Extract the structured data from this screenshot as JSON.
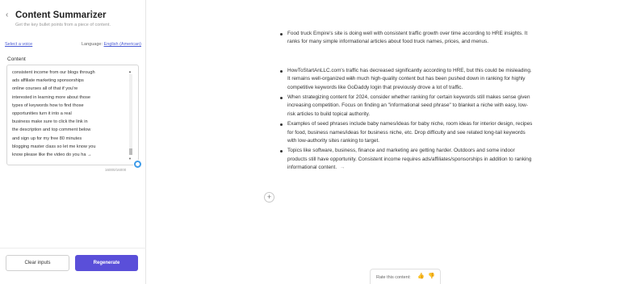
{
  "header": {
    "back_icon": "chevron-left-icon",
    "title": "Content Summarizer",
    "star_icon": "star-icon",
    "subtitle": "Get the key bullet points from a piece of content."
  },
  "voice": {
    "link": "Select a voice",
    "language_label": "Language:",
    "language_value": "English (American)"
  },
  "content": {
    "label": "Content",
    "lines": [
      "consistent income from our blogs through",
      "ads affiliate marketing sponsorships",
      "online courses all of that if you're",
      "interested in learning more about those",
      "types of keywords how to find those",
      "opportunities turn it into a real",
      "business make sure to click the link in",
      "the description and top comment below",
      "and sign up for my free 80 minutes",
      "blogging master class so let me know you",
      "know please like the video do you ha →"
    ],
    "char_count": "16000/16000"
  },
  "footer": {
    "clear_label": "Clear inputs",
    "regenerate_label": "Regenerate"
  },
  "summary": {
    "bullets": [
      "Food truck Empire's site is doing well with consistent traffic growth over time according to HRE insights. It ranks for many simple informational articles about food truck names, prices, and menus.",
      "HowToStartAnLLC.com's traffic has decreased significantly according to HRE, but this could be misleading. It remains well-organized with much high-quality content but has been pushed down in ranking for highly competitive keywords like GoDaddy login that previously drove a lot of traffic.",
      "When strategizing content for 2024, consider whether ranking for certain keywords still makes sense given increasing competition. Focus on finding an \"informational seed phrase\" to blanket a niche with easy, low-risk articles to build topical authority.",
      "Examples of seed phrases include baby names/ideas for baby niche, room ideas for interior design, recipes for food, business names/ideas for business niche, etc. Drop difficulty and see related long-tail keywords with low-authority sites ranking to target.",
      "Topics like software, business, finance and marketing are getting harder. Outdoors and some indoor products still have opportunity. Consistent income requires ads/affiliates/sponsorships in addition to ranking informational content."
    ],
    "continue_arrow": "→"
  },
  "add_button": "+",
  "rating": {
    "label": "Rate this content:",
    "up_icon": "thumbs-up-icon",
    "down_icon": "thumbs-down-icon"
  }
}
